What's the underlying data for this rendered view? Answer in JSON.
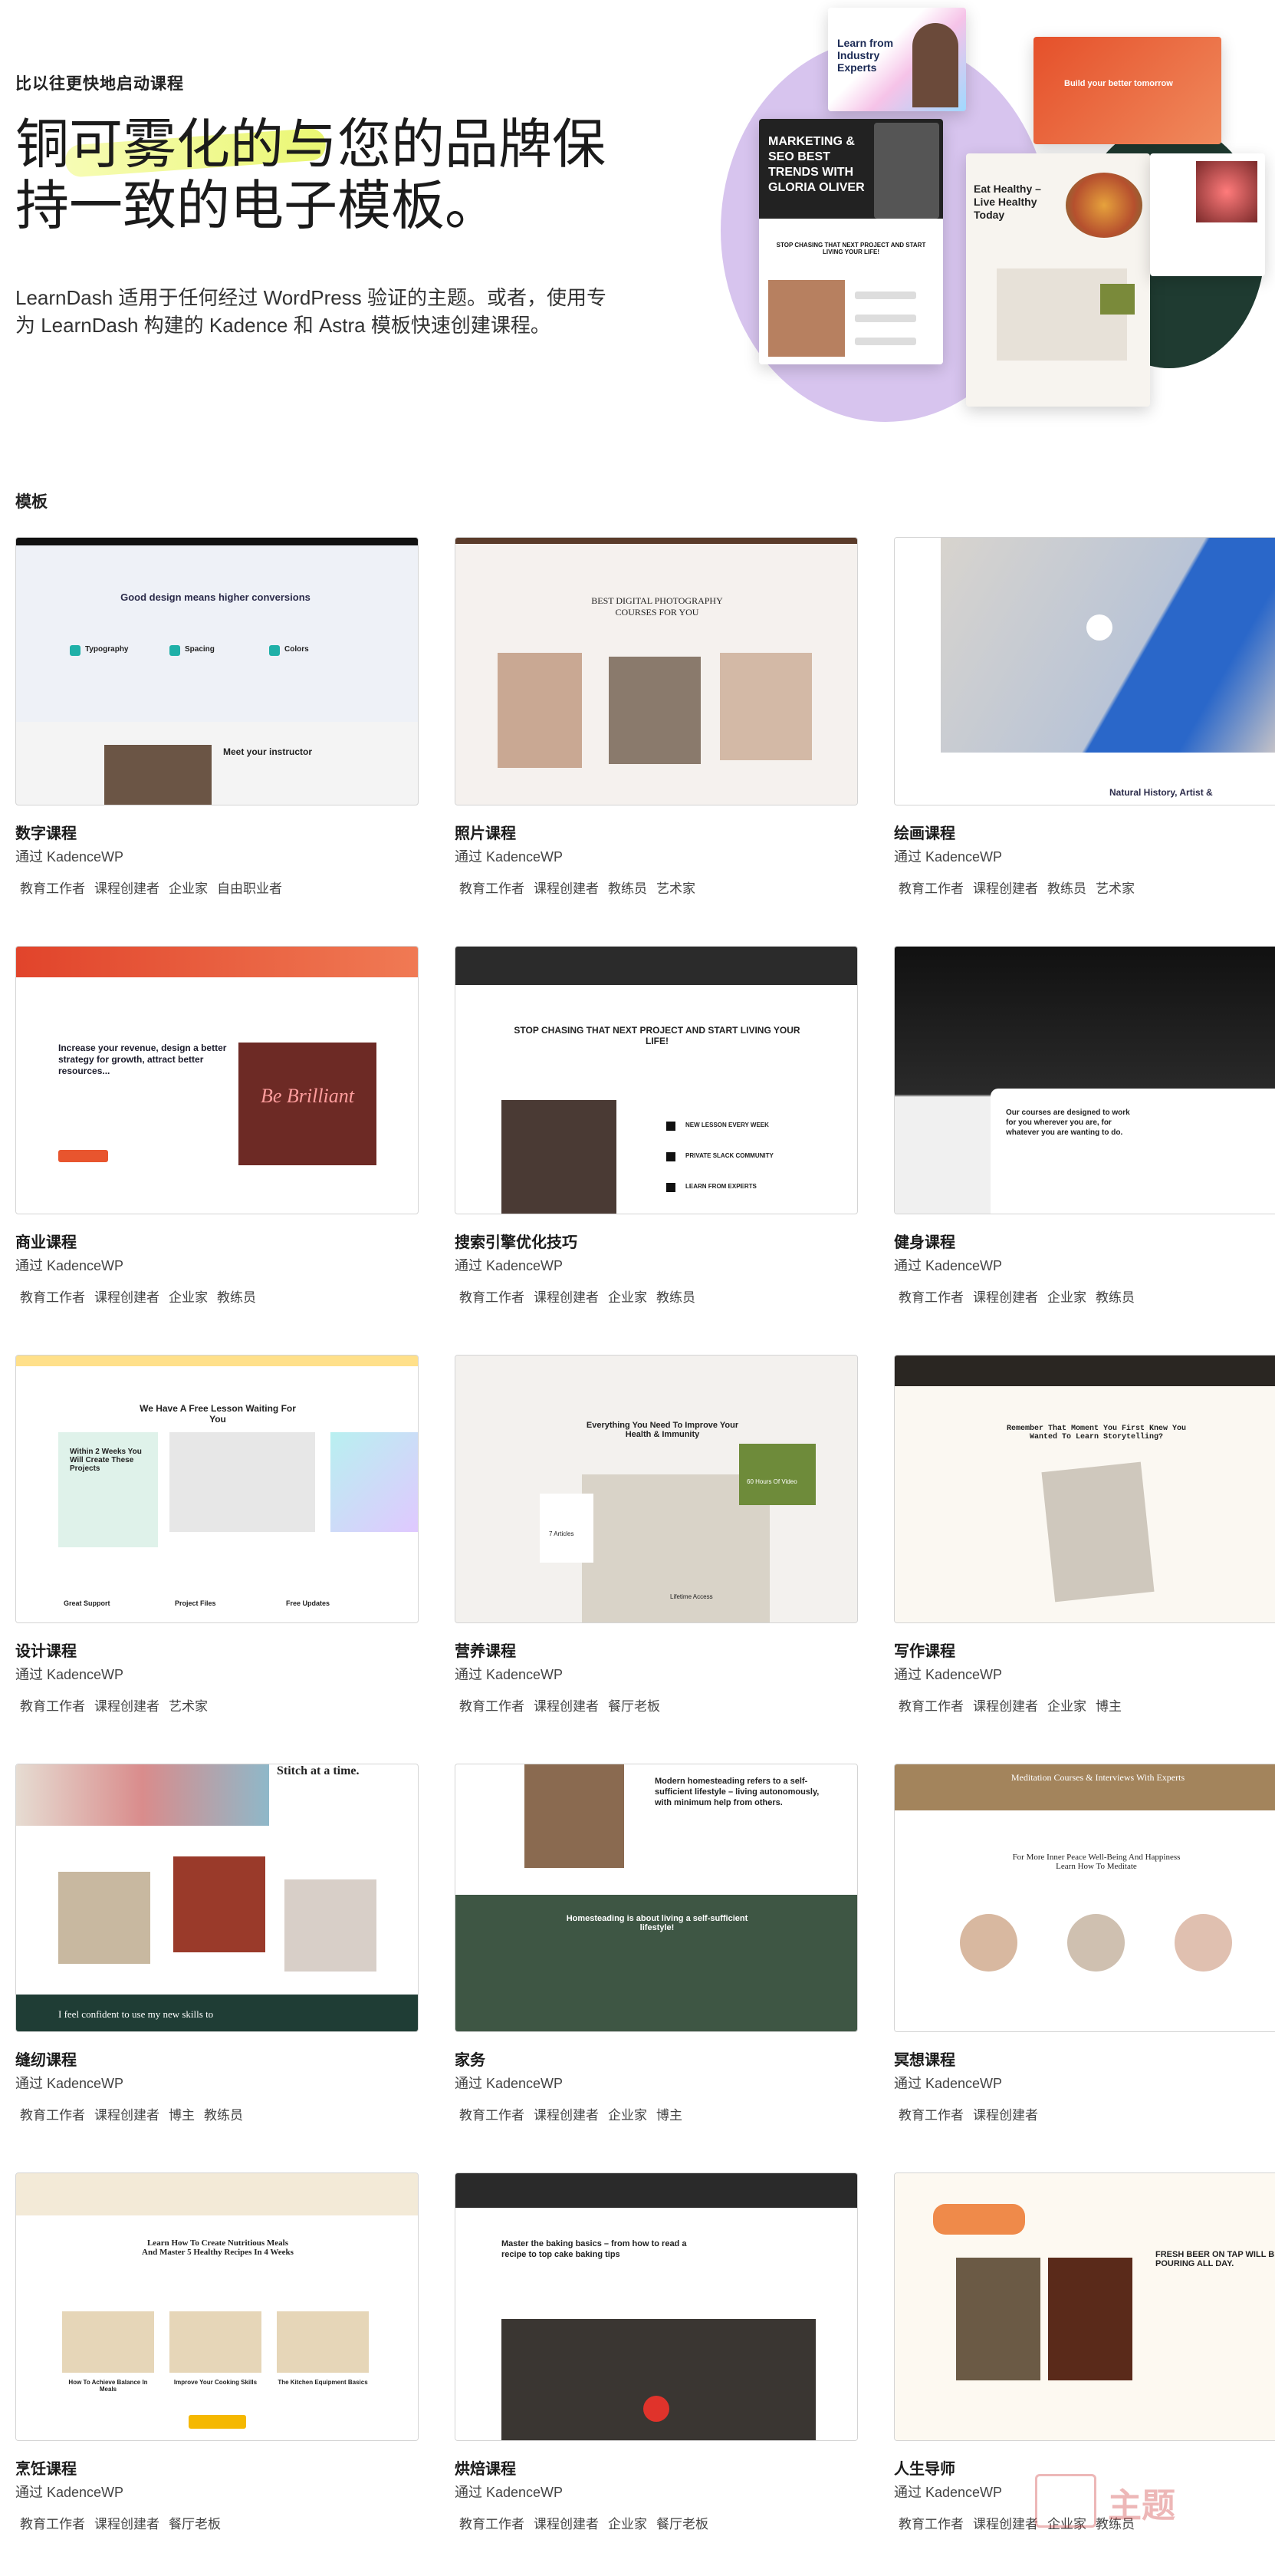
{
  "hero": {
    "eyebrow": "比以往更快地启动课程",
    "headline": "铜可雾化的与您的品牌保持一致的电子模板。",
    "lead": "LearnDash 适用于任何经过 WordPress 验证的主题。或者，使用专为 LearnDash 构建的 Kadence 和 Astra 模板快速创建课程。",
    "collage": {
      "shot1_title": "Learn from Industry Experts",
      "shot2_title": "Build your better tomorrow",
      "shot3_title": "MARKETING & SEO BEST TRENDS WITH GLORIA OLIVER",
      "shot4_title": "Eat Healthy – Live Healthy Today",
      "shot5_text": "STOP CHASING THAT NEXT PROJECT AND START LIVING YOUR LIFE!"
    }
  },
  "section": {
    "title": "模板"
  },
  "cards": [
    {
      "title": "数字课程",
      "by": "通过 KadenceWP",
      "tags": [
        "教育工作者",
        "课程创建者",
        "企业家",
        "自由职业者"
      ],
      "preview": {
        "headline": "Good design means higher conversions",
        "sub": "Meet your instructor",
        "items": [
          "Typography",
          "Spacing",
          "Colors"
        ]
      }
    },
    {
      "title": "照片课程",
      "by": "通过 KadenceWP",
      "tags": [
        "教育工作者",
        "课程创建者",
        "教练员",
        "艺术家"
      ],
      "preview": {
        "headline": "BEST DIGITAL PHOTOGRAPHY COURSES FOR YOU"
      }
    },
    {
      "title": "绘画课程",
      "by": "通过 KadenceWP",
      "tags": [
        "教育工作者",
        "课程创建者",
        "教练员",
        "艺术家"
      ],
      "preview": {
        "headline": "Natural History, Artist &"
      }
    },
    {
      "title": "商业课程",
      "by": "通过 KadenceWP",
      "tags": [
        "教育工作者",
        "课程创建者",
        "企业家",
        "教练员"
      ],
      "preview": {
        "headline": "Increase your revenue, design a better strategy for growth, attract better resources...",
        "neon": "Be Brilliant"
      }
    },
    {
      "title": "搜索引擎优化技巧",
      "by": "通过 KadenceWP",
      "tags": [
        "教育工作者",
        "课程创建者",
        "企业家",
        "教练员"
      ],
      "preview": {
        "headline": "STOP CHASING THAT NEXT PROJECT AND START LIVING YOUR LIFE!",
        "items": [
          "NEW LESSON EVERY WEEK",
          "PRIVATE SLACK COMMUNITY",
          "LEARN FROM EXPERTS"
        ]
      }
    },
    {
      "title": "健身课程",
      "by": "通过 KadenceWP",
      "tags": [
        "教育工作者",
        "课程创建者",
        "企业家",
        "教练员"
      ],
      "preview": {
        "headline": "Our courses are designed to work for you wherever you are, for whatever you are wanting to do."
      }
    },
    {
      "title": "设计课程",
      "by": "通过 KadenceWP",
      "tags": [
        "教育工作者",
        "课程创建者",
        "艺术家"
      ],
      "preview": {
        "headline": "We Have A Free Lesson Waiting For You",
        "side": "Within 2 Weeks You Will Create These Projects",
        "items": [
          "Great Support",
          "Project Files",
          "Free Updates"
        ]
      }
    },
    {
      "title": "营养课程",
      "by": "通过 KadenceWP",
      "tags": [
        "教育工作者",
        "课程创建者",
        "餐厅老板"
      ],
      "preview": {
        "headline": "Everything You Need To Improve Your Health & Immunity",
        "items": [
          "7 Articles",
          "Lifetime Access",
          "60 Hours Of Video"
        ]
      }
    },
    {
      "title": "写作课程",
      "by": "通过 KadenceWP",
      "tags": [
        "教育工作者",
        "课程创建者",
        "企业家",
        "博主"
      ],
      "preview": {
        "headline": "Remember That Moment You First Knew You Wanted To Learn Storytelling?"
      }
    },
    {
      "title": "缝纫课程",
      "by": "通过 KadenceWP",
      "tags": [
        "教育工作者",
        "课程创建者",
        "博主",
        "教练员"
      ],
      "preview": {
        "headline": "Stitch at a time.",
        "quote": "I feel confident to use my new skills to"
      }
    },
    {
      "title": "家务",
      "by": "通过 KadenceWP",
      "tags": [
        "教育工作者",
        "课程创建者",
        "企业家",
        "博主"
      ],
      "preview": {
        "headline": "Modern homesteading refers to a self-sufficient lifestyle – living autonomously, with minimum help from others.",
        "band": "Homesteading is about living a self-sufficient lifestyle!"
      }
    },
    {
      "title": "冥想课程",
      "by": "通过 KadenceWP",
      "tags": [
        "教育工作者",
        "课程创建者"
      ],
      "preview": {
        "headline": "For More Inner Peace Well-Being And Happiness Learn How To Meditate",
        "top": "Meditation Courses & Interviews With Experts"
      }
    },
    {
      "title": "烹饪课程",
      "by": "通过 KadenceWP",
      "tags": [
        "教育工作者",
        "课程创建者",
        "餐厅老板"
      ],
      "preview": {
        "headline": "Learn How To Create Nutritious Meals And Master 5 Healthy Recipes In 4 Weeks",
        "items": [
          "How To Achieve Balance In Meals",
          "Improve Your Cooking Skills",
          "The Kitchen Equipment Basics"
        ]
      }
    },
    {
      "title": "烘焙课程",
      "by": "通过 KadenceWP",
      "tags": [
        "教育工作者",
        "课程创建者",
        "企业家",
        "餐厅老板"
      ],
      "preview": {
        "headline": "Master the baking basics – from how to read a recipe to top cake baking tips"
      }
    },
    {
      "title": "人生导师",
      "by": "通过 KadenceWP",
      "tags": [
        "教育工作者",
        "课程创建者",
        "企业家",
        "教练员"
      ],
      "preview": {
        "headline": "FRESH BEER ON TAP WILL BE POURING ALL DAY."
      }
    }
  ],
  "watermark": {
    "text": "主题"
  }
}
